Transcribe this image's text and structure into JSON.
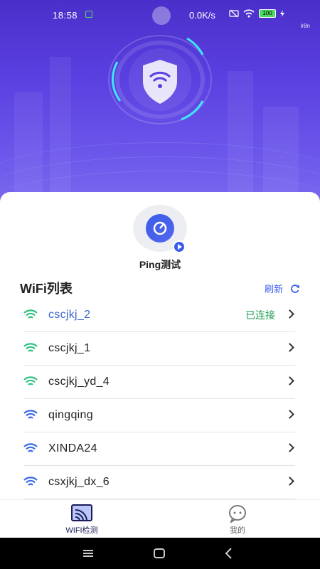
{
  "status_bar": {
    "time": "18:58",
    "net_speed": "0.0K/s",
    "battery": "100",
    "carrier": "lr8n"
  },
  "ping": {
    "label": "Ping测试"
  },
  "wifi_list": {
    "title": "WiFi列表",
    "refresh_label": "刷新",
    "items": [
      {
        "name": "cscjkj_2",
        "status": "已连接",
        "signal_color": "#2fc27e",
        "connected": true
      },
      {
        "name": "cscjkj_1",
        "status": "",
        "signal_color": "#2fc27e",
        "connected": false
      },
      {
        "name": "cscjkj_yd_4",
        "status": "",
        "signal_color": "#2fc27e",
        "connected": false
      },
      {
        "name": "qingqing",
        "status": "",
        "signal_color": "#3a6ae8",
        "connected": false
      },
      {
        "name": "XINDA24",
        "status": "",
        "signal_color": "#3a6ae8",
        "connected": false
      },
      {
        "name": "csxjkj_dx_6",
        "status": "",
        "signal_color": "#3a6ae8",
        "connected": false
      }
    ]
  },
  "tabs": [
    {
      "label": "WIFI检测",
      "active": true
    },
    {
      "label": "我的",
      "active": false
    }
  ],
  "colors": {
    "accent": "#3a5cf0",
    "hero": "#5a3fe0",
    "connected_text": "#1f9d55"
  }
}
